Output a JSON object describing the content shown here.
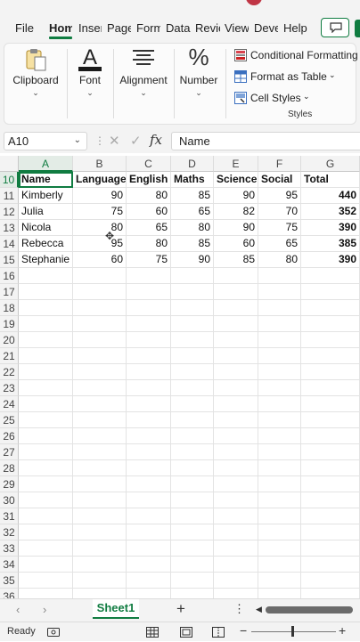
{
  "ribbon_tabs": [
    {
      "label": "File"
    },
    {
      "label": "Home"
    },
    {
      "label": "Insert"
    },
    {
      "label": "Page Layout"
    },
    {
      "label": "Formulas"
    },
    {
      "label": "Data"
    },
    {
      "label": "Review"
    },
    {
      "label": "View"
    },
    {
      "label": "Developer"
    },
    {
      "label": "Help"
    }
  ],
  "active_tab": "Home",
  "ribbon": {
    "clipboard": "Clipboard",
    "font": "Font",
    "alignment": "Alignment",
    "number": "Number",
    "conditional_formatting": "Conditional Formatting",
    "format_as_table": "Format as Table",
    "cell_styles": "Cell Styles",
    "styles_group": "Styles",
    "number_icon": "%",
    "font_icon": "A"
  },
  "formula_bar": {
    "name_box": "A10",
    "fx": "fx",
    "content": "Name"
  },
  "columns": [
    "A",
    "B",
    "C",
    "D",
    "E",
    "F",
    "G"
  ],
  "rows": [
    "10",
    "11",
    "12",
    "13",
    "14",
    "15",
    "16",
    "17",
    "18",
    "19",
    "20",
    "21",
    "22",
    "23",
    "24",
    "25",
    "26",
    "27",
    "28",
    "29",
    "30",
    "31",
    "32",
    "33",
    "34",
    "35",
    "36"
  ],
  "table": {
    "headers": [
      "Name",
      "Language",
      "English",
      "Maths",
      "Science",
      "Social",
      "Total"
    ],
    "rows": [
      [
        "Kimberly",
        "90",
        "80",
        "85",
        "90",
        "95",
        "440"
      ],
      [
        "Julia",
        "75",
        "60",
        "65",
        "82",
        "70",
        "352"
      ],
      [
        "Nicola",
        "80",
        "65",
        "80",
        "90",
        "75",
        "390"
      ],
      [
        "Rebecca",
        "95",
        "80",
        "85",
        "60",
        "65",
        "385"
      ],
      [
        "Stephanie",
        "60",
        "75",
        "90",
        "85",
        "80",
        "390"
      ]
    ]
  },
  "sheet_tabs": [
    {
      "label": "Sheet1"
    }
  ],
  "status": {
    "ready": "Ready",
    "zoom_minus": "−",
    "zoom_plus": "+"
  },
  "colors": {
    "accent": "#107c41",
    "ribbon_bg": "#f3f3f3"
  },
  "icons": {
    "comment": "comment-icon",
    "clipboard": "clipboard-icon",
    "alignment": "align-lines-icon"
  }
}
